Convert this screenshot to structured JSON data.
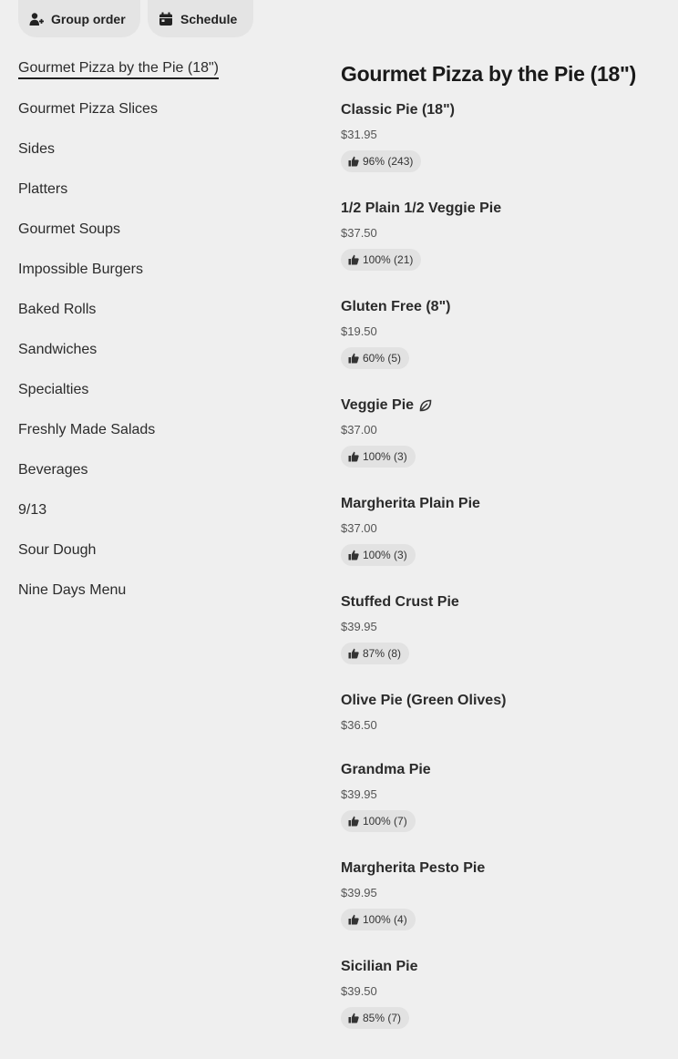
{
  "toolbar": {
    "group_order_label": "Group order",
    "schedule_label": "Schedule"
  },
  "nav": {
    "items": [
      {
        "label": "Gourmet Pizza by the Pie (18\")",
        "active": true
      },
      {
        "label": "Gourmet Pizza Slices"
      },
      {
        "label": "Sides"
      },
      {
        "label": "Platters"
      },
      {
        "label": "Gourmet Soups"
      },
      {
        "label": "Impossible Burgers"
      },
      {
        "label": "Baked Rolls"
      },
      {
        "label": "Sandwiches"
      },
      {
        "label": "Specialties"
      },
      {
        "label": "Freshly Made Salads"
      },
      {
        "label": "Beverages"
      },
      {
        "label": "9/13"
      },
      {
        "label": "Sour Dough"
      },
      {
        "label": "Nine Days Menu"
      }
    ]
  },
  "section": {
    "title": "Gourmet Pizza by the Pie (18\")",
    "items": [
      {
        "name": "Classic Pie (18\")",
        "price": "$31.95",
        "rating": "96% (243)"
      },
      {
        "name": "1/2 Plain 1/2 Veggie Pie",
        "price": "$37.50",
        "rating": "100% (21)"
      },
      {
        "name": "Gluten Free (8\")",
        "price": "$19.50",
        "rating": "60% (5)"
      },
      {
        "name": "Veggie Pie",
        "price": "$37.00",
        "rating": "100% (3)",
        "icon": "leaf-icon"
      },
      {
        "name": "Margherita Plain Pie",
        "price": "$37.00",
        "rating": "100% (3)"
      },
      {
        "name": "Stuffed Crust Pie",
        "price": "$39.95",
        "rating": "87% (8)"
      },
      {
        "name": "Olive Pie (Green Olives)",
        "price": "$36.50"
      },
      {
        "name": "Grandma Pie",
        "price": "$39.95",
        "rating": "100% (7)"
      },
      {
        "name": "Margherita Pesto Pie",
        "price": "$39.95",
        "rating": "100% (4)"
      },
      {
        "name": "Sicilian Pie",
        "price": "$39.50",
        "rating": "85% (7)"
      }
    ]
  },
  "icons": {
    "group_order": "add-person-icon",
    "schedule": "calendar-icon",
    "rating": "thumbs-up-icon",
    "vegetarian": "leaf-icon"
  }
}
